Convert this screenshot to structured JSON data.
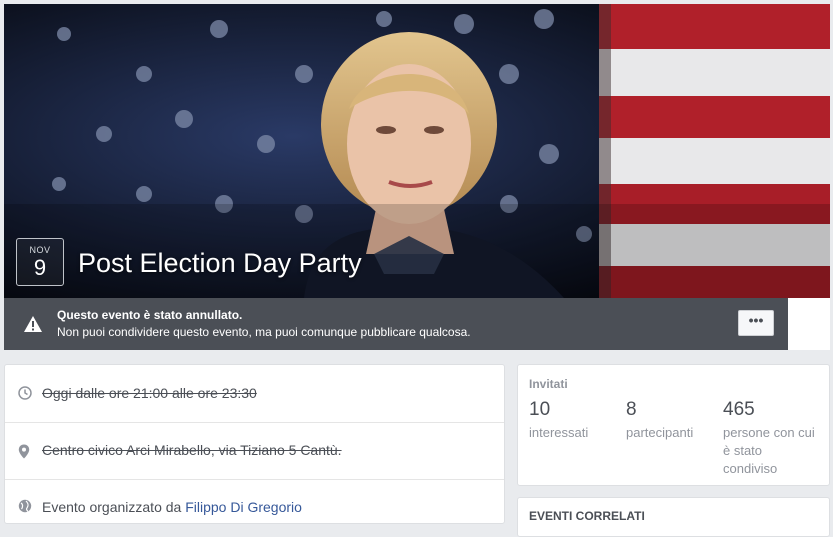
{
  "event": {
    "date_month": "NOV",
    "date_day": "9",
    "title": "Post Election Day Party"
  },
  "cancel_notice": {
    "heading": "Questo evento è stato annullato.",
    "message": "Non puoi condividere questo evento, ma puoi comunque pubblicare qualcosa.",
    "more_label": "•••"
  },
  "details": {
    "time": "Oggi dalle ore 21:00 alle ore 23:30",
    "location": "Centro civico Arci Mirabello, via Tiziano 5 Cantù.",
    "organizer_prefix": "Evento organizzato da ",
    "organizer_name": "Filippo Di Gregorio"
  },
  "invited": {
    "heading": "Invitati",
    "interested_count": "10",
    "interested_label": "interessati",
    "going_count": "8",
    "going_label": "partecipanti",
    "shared_count": "465",
    "shared_label": "persone con cui è stato condiviso"
  },
  "related": {
    "heading": "EVENTI CORRELATI"
  },
  "colors": {
    "link": "#365899",
    "cancel_bar": "#4b4f56",
    "flag_red": "#b0202a",
    "flag_blue": "#1c2a55"
  },
  "icons": {
    "warning": "warning-icon",
    "clock": "clock-icon",
    "location": "map-pin-icon",
    "globe": "globe-icon"
  }
}
